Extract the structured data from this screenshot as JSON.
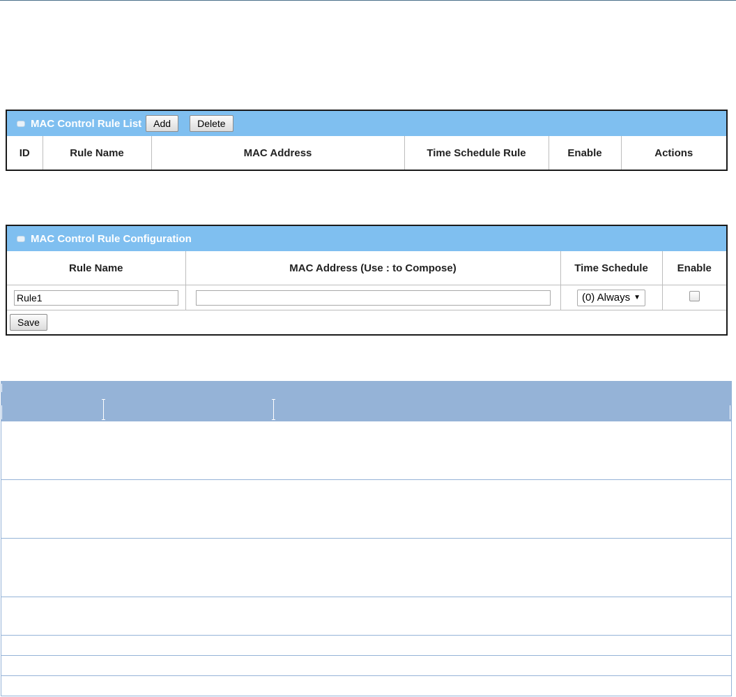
{
  "rule_list": {
    "title": "MAC Control Rule List",
    "add_label": "Add",
    "delete_label": "Delete",
    "columns": [
      "ID",
      "Rule Name",
      "MAC Address",
      "Time Schedule Rule",
      "Enable",
      "Actions"
    ]
  },
  "rule_config": {
    "title": "MAC Control Rule Configuration",
    "columns": [
      "Rule Name",
      "MAC Address (Use : to Compose)",
      "Time Schedule",
      "Enable"
    ],
    "rule_name_value": "Rule1",
    "mac_value": "",
    "time_schedule_selected": "(0) Always",
    "enable_checked": false,
    "save_label": "Save"
  },
  "colors": {
    "panel_header": "#7fbff0",
    "doc_table_header": "#95b3d7"
  }
}
